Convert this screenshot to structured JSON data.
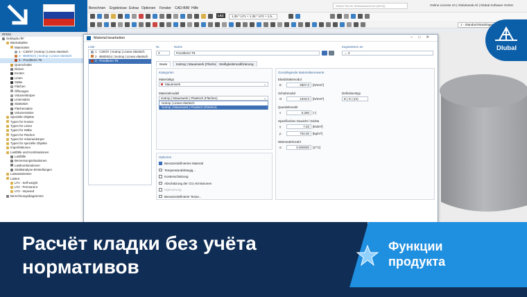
{
  "colors": {
    "brand_blue": "#0b5ea8",
    "banner_dark": "#0f2d55",
    "banner_light": "#1f8fe0",
    "selection": "#3d6fb5"
  },
  "menu": [
    "Berechnen",
    "Ergebnisse",
    "Extras",
    "Optionen",
    "Fenster",
    "CAD-BIM",
    "Hilfe"
  ],
  "search_placeholder": "Geben Sie ein Schlüsselwort ein (Alt+Q)",
  "license": "Online License 10 | Abdulrazak Ali | Dlubal Software GmbH",
  "lk": {
    "badge": "LK2",
    "formula": "1.35 * LF1 + 1.35 * LF2 + 1.5..."
  },
  "load_combo": "1 - Standard-Basislager",
  "navigator": {
    "title": "RFEM",
    "rows": [
      {
        "label": "Gebäude.rf6*",
        "indent": 0,
        "icon": "#777"
      },
      {
        "label": "Basisobjekte",
        "indent": 1,
        "icon": "#d9b04a"
      },
      {
        "label": "Materialien",
        "indent": 2,
        "icon": "#d9b04a"
      },
      {
        "label": "1 - C30/37 | Isotrop | Linear elastisch",
        "indent": 3,
        "icon": "#9aa3ad"
      },
      {
        "label": "2 - B500S(A) | Isotrop | Linear elastisch",
        "indent": 3,
        "icon": "#c87a3a",
        "hl": true
      },
      {
        "label": "3 - Porotherm T8",
        "indent": 3,
        "icon": "#b0451c",
        "sel": true
      },
      {
        "label": "Querschnitte",
        "indent": 2,
        "icon": "#c9963a"
      },
      {
        "label": "Dicken",
        "indent": 2,
        "icon": "#777"
      },
      {
        "label": "Knoten",
        "indent": 2,
        "icon": "#333"
      },
      {
        "label": "Linien",
        "indent": 2,
        "icon": "#333"
      },
      {
        "label": "Stäbe",
        "indent": 2,
        "icon": "#333"
      },
      {
        "label": "Flächen",
        "indent": 2,
        "icon": "#999"
      },
      {
        "label": "Öffnungen",
        "indent": 2,
        "icon": "#999"
      },
      {
        "label": "Volumenkörper",
        "indent": 2,
        "icon": "#999"
      },
      {
        "label": "Liniensätze",
        "indent": 2,
        "icon": "#777"
      },
      {
        "label": "Stabsätze",
        "indent": 2,
        "icon": "#777"
      },
      {
        "label": "Flächensätze",
        "indent": 2,
        "icon": "#777"
      },
      {
        "label": "Volumensätze",
        "indent": 2,
        "icon": "#777"
      },
      {
        "label": "Spezielle Objekte",
        "indent": 1,
        "icon": "#d9b04a"
      },
      {
        "label": "Typen für Knoten",
        "indent": 1,
        "icon": "#d9b04a"
      },
      {
        "label": "Typen für Linien",
        "indent": 1,
        "icon": "#d9b04a"
      },
      {
        "label": "Typen für Stäbe",
        "indent": 1,
        "icon": "#d9b04a"
      },
      {
        "label": "Typen für Flächen",
        "indent": 1,
        "icon": "#d9b04a"
      },
      {
        "label": "Typen für Volumenkörper",
        "indent": 1,
        "icon": "#d9b04a"
      },
      {
        "label": "Typen für spezielle Objekte",
        "indent": 1,
        "icon": "#d9b04a"
      },
      {
        "label": "Imperfektionen",
        "indent": 1,
        "icon": "#d9b04a"
      },
      {
        "label": "Lastfälle und Kombinationen",
        "indent": 1,
        "icon": "#d9b04a"
      },
      {
        "label": "Lastfälle",
        "indent": 2,
        "icon": "#777"
      },
      {
        "label": "Bemessungssituationen",
        "indent": 2,
        "icon": "#777"
      },
      {
        "label": "Lastkombinationen",
        "indent": 2,
        "icon": "#777"
      },
      {
        "label": "Statikanalyse-Einstellungen",
        "indent": 2,
        "icon": "#777"
      },
      {
        "label": "Lastassistenten",
        "indent": 1,
        "icon": "#d9b04a"
      },
      {
        "label": "Lasten",
        "indent": 1,
        "icon": "#d9b04a"
      },
      {
        "label": "LF1 - Self-weight",
        "indent": 2,
        "icon": "#d9b04a"
      },
      {
        "label": "LF2 - Permanent",
        "indent": 2,
        "icon": "#d9b04a"
      },
      {
        "label": "LF3 - Imposed",
        "indent": 2,
        "icon": "#d9b04a"
      },
      {
        "label": "Berechnungsdiagramme",
        "indent": 1,
        "icon": "#777"
      }
    ]
  },
  "dialog": {
    "title": "Material bearbeiten",
    "list_label": "Liste",
    "list": [
      {
        "label": "1 · C30/37 | Isotrop | Linear elastisch",
        "color": "#9aa3ad"
      },
      {
        "label": "2 · B500S(A) | Isotrop | Linear elastisch",
        "color": "#c87a3a"
      },
      {
        "label": "3 · Porotherm T8",
        "color": "#b0451c",
        "sel": true
      }
    ],
    "no_label": "Nr.",
    "no_value": "3",
    "name_label": "Name",
    "name_value": "Porotherm T8",
    "assign_label": "Zugewiesen an",
    "assign_value": "3",
    "tabs": [
      "Basis",
      "Isotrop | Mauerwerk (Flächen)",
      "Steifigkeitsmodifizierung"
    ],
    "kategorien": "Kategorien",
    "materialtyp_label": "Materialtyp",
    "materialtyp_value": "Mauerwerk",
    "materialmodell_label": "Materialmodell",
    "materialmodell_value": "Isotrop | Mauerwerk | Plastisch (Flächen)",
    "modell_options": [
      "Isotrop | Linear elastisch",
      "Isotrop | Mauerwerk | Plastisch (Flächen)"
    ],
    "grund_title": "Grundlegende Materialkennwerte",
    "e_section": "Elastizitätsmodul",
    "e_sym": "E",
    "e_val": "2607.0",
    "e_unit": "[N/mm²]",
    "g_section": "Schubmodul",
    "g_sym": "G",
    "g_val": "1043.0",
    "g_unit": "[N/mm²]",
    "def_label": "Definitionstyp",
    "def_value": "E | G | (m)",
    "nu_section": "Querdehnzahl",
    "nu_sym": "ν",
    "nu_val": "0.250",
    "nu_unit": "[–]",
    "weight_section": "Spezifisches Gewicht / Dichte",
    "gamma_sym": "γ",
    "gamma_val": "7.02",
    "gamma_unit": "[kN/m³]",
    "rho_sym": "ρ",
    "rho_val": "702.00",
    "rho_unit": "[kg/m³]",
    "alpha_section": "Wärmedehnzahl",
    "alpha_sym": "α",
    "alpha_val": "0.000000",
    "alpha_unit": "[1/°C]",
    "options_title": "Optionen",
    "options": [
      {
        "label": "Benutzerdefiniertes Material",
        "checked": true
      },
      {
        "label": "Temperaturabhängig...",
        "checked": false
      },
      {
        "label": "Kostenschätzung",
        "checked": false
      },
      {
        "label": "Abschätzung der CO₂-Emissionen",
        "checked": false
      },
      {
        "label": "Optimierung",
        "checked": false,
        "disabled": true
      },
      {
        "label": "Benutzerdefinierte Textur...",
        "checked": false
      }
    ]
  },
  "banner": {
    "headline": "Расчёт кладки без учёта нормативов",
    "feature": "Функции продукта"
  },
  "logo": "Dlubal"
}
